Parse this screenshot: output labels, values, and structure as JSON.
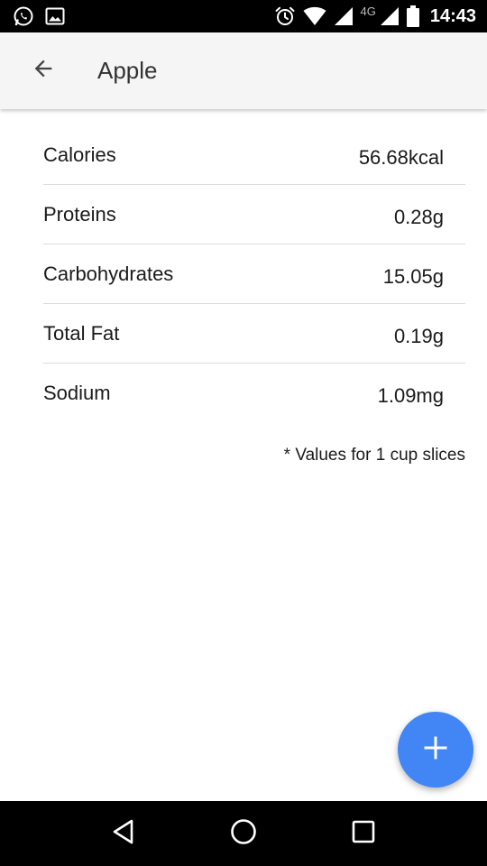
{
  "status_bar": {
    "network_label": "4G",
    "time": "14:43",
    "icons": [
      "whatsapp-icon",
      "image-icon",
      "alarm-icon",
      "wifi-icon",
      "signal-icon",
      "signal-icon",
      "battery-icon"
    ]
  },
  "app_bar": {
    "title": "Apple",
    "back_icon": "arrow-back-icon"
  },
  "nutrition": {
    "rows": [
      {
        "label": "Calories",
        "value": "56.68kcal"
      },
      {
        "label": "Proteins",
        "value": "0.28g"
      },
      {
        "label": "Carbohydrates",
        "value": "15.05g"
      },
      {
        "label": "Total Fat",
        "value": "0.19g"
      },
      {
        "label": "Sodium",
        "value": "1.09mg"
      }
    ],
    "footnote": "* Values for 1 cup slices"
  },
  "fab": {
    "icon": "plus-icon",
    "color": "#4285f4"
  },
  "nav_bar": {
    "icons": [
      "back-triangle-icon",
      "home-circle-icon",
      "recents-square-icon"
    ]
  }
}
